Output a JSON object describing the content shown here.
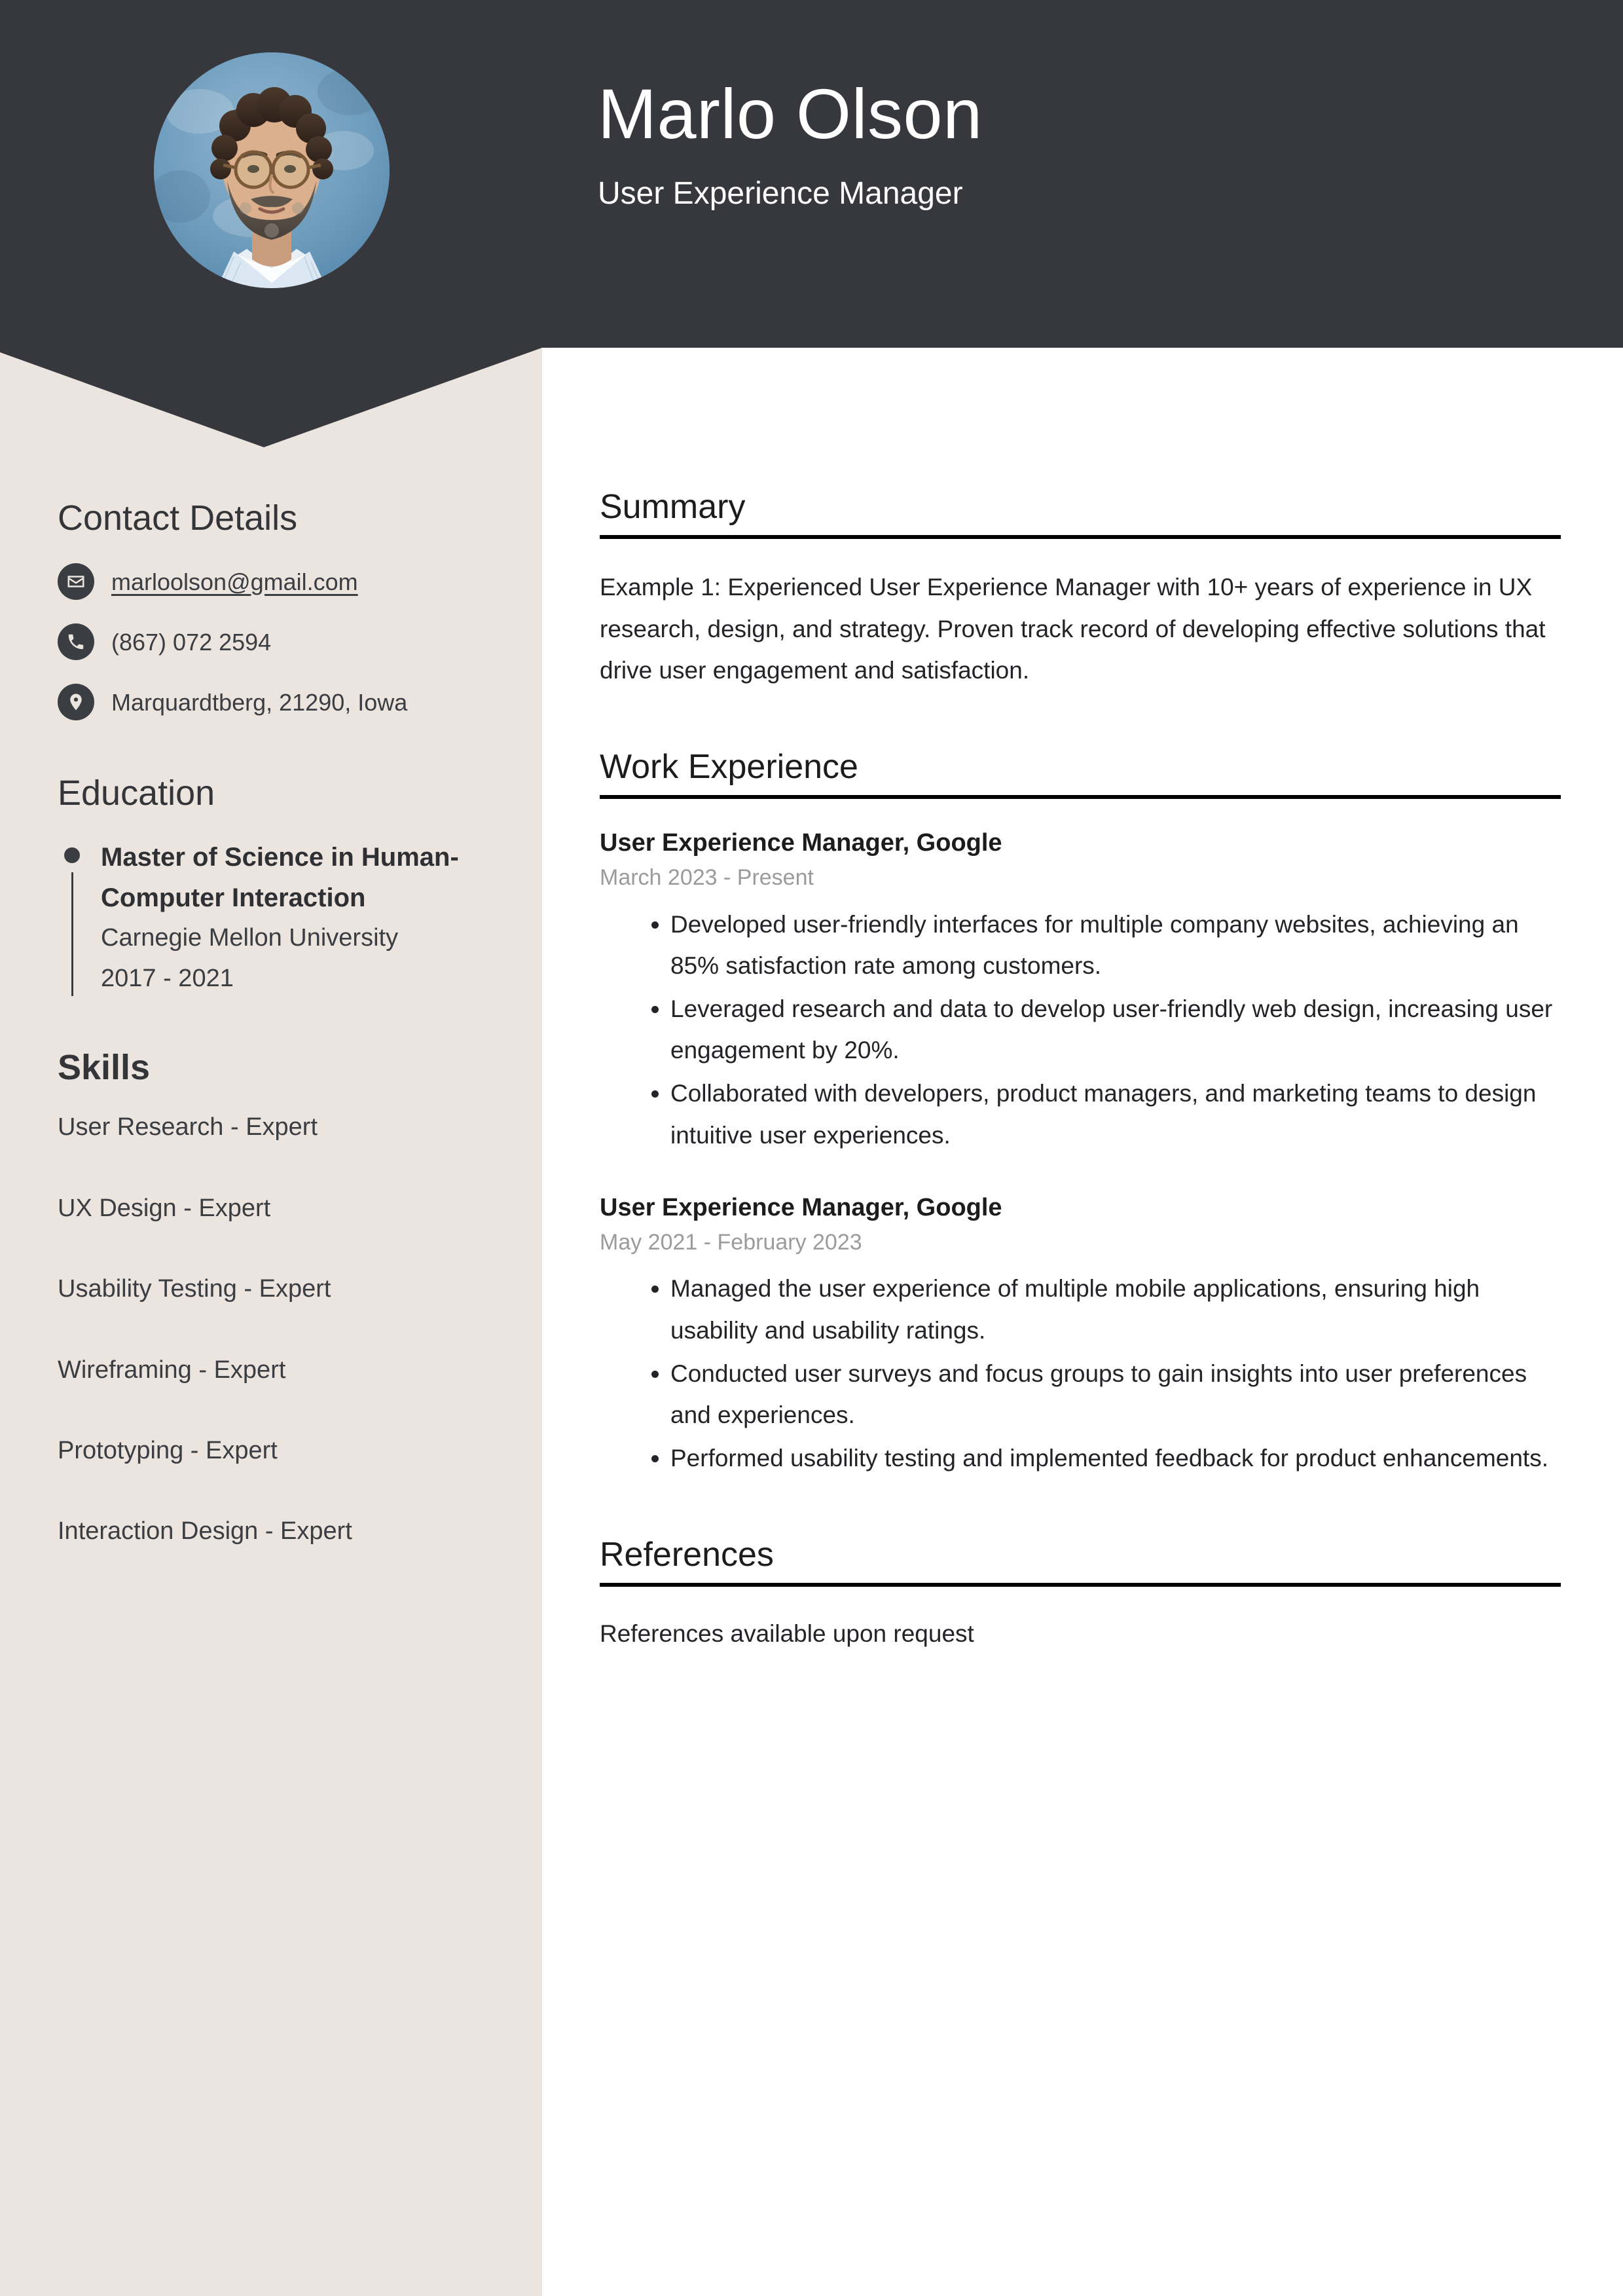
{
  "colors": {
    "header_bg": "#36383D",
    "sidebar_bg": "#ECE4DF",
    "page_bg": "#FFFFFF",
    "rule": "#000000",
    "muted_text": "#9B9B9B"
  },
  "header": {
    "name": "Marlo Olson",
    "job_title": "User Experience Manager",
    "avatar_alt": "profile-photo"
  },
  "sidebar": {
    "contact": {
      "heading": "Contact Details",
      "items": [
        {
          "icon": "envelope-icon",
          "text": "marloolson@gmail.com",
          "is_link": true
        },
        {
          "icon": "phone-icon",
          "text": "(867) 072 2594",
          "is_link": false
        },
        {
          "icon": "location-pin-icon",
          "text": "Marquardtberg, 21290, Iowa",
          "is_link": false
        }
      ]
    },
    "education": {
      "heading": "Education",
      "items": [
        {
          "degree": "Master of Science in Human-Computer Interaction",
          "school": "Carnegie Mellon University",
          "years": "2017 - 2021"
        }
      ]
    },
    "skills": {
      "heading": "Skills",
      "items": [
        "User Research - Expert",
        "UX Design - Expert",
        "Usability Testing - Expert",
        "Wireframing - Expert",
        "Prototyping - Expert",
        "Interaction Design - Expert"
      ]
    }
  },
  "main": {
    "summary": {
      "heading": "Summary",
      "text": "Example 1: Experienced User Experience Manager with 10+ years of experience in UX research, design, and strategy. Proven track record of developing effective solutions that drive user engagement and satisfaction."
    },
    "work": {
      "heading": "Work Experience",
      "jobs": [
        {
          "title": "User Experience Manager, Google",
          "dates": "March 2023 - Present",
          "bullets": [
            "Developed user-friendly interfaces for multiple company websites, achieving an 85% satisfaction rate among customers.",
            "Leveraged research and data to develop user-friendly web design, increasing user engagement by 20%.",
            "Collaborated with developers, product managers, and marketing teams to design intuitive user experiences."
          ]
        },
        {
          "title": "User Experience Manager, Google",
          "dates": "May 2021 - February 2023",
          "bullets": [
            "Managed the user experience of multiple mobile applications, ensuring high usability and usability ratings.",
            "Conducted user surveys and focus groups to gain insights into user preferences and experiences.",
            "Performed usability testing and implemented feedback for product enhancements."
          ]
        }
      ]
    },
    "references": {
      "heading": "References",
      "text": "References available upon request"
    }
  }
}
